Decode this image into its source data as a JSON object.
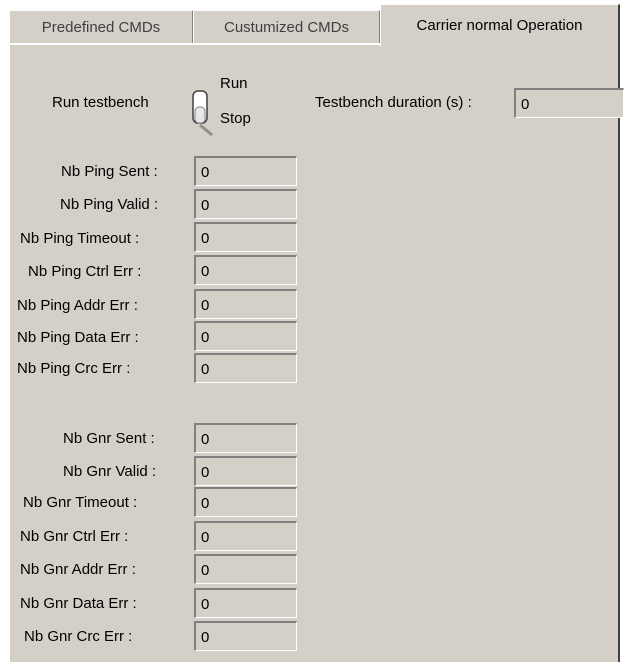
{
  "tabs": [
    {
      "label": "Predefined CMDs",
      "active": false
    },
    {
      "label": "Custumized CMDs",
      "active": false
    },
    {
      "label": "Carrier normal Operation",
      "active": true
    }
  ],
  "testbench": {
    "run_label": "Run testbench",
    "toggle_on_label": "Run",
    "toggle_off_label": "Stop",
    "toggle_state": "Stop",
    "duration_label": "Testbench duration (s) :",
    "duration_value": "0"
  },
  "ping": [
    {
      "label": "Nb Ping Sent :",
      "value": "0"
    },
    {
      "label": "Nb Ping Valid :",
      "value": "0"
    },
    {
      "label": "Nb Ping Timeout :",
      "value": "0"
    },
    {
      "label": "Nb Ping Ctrl Err :",
      "value": "0"
    },
    {
      "label": "Nb Ping Addr Err :",
      "value": "0"
    },
    {
      "label": "Nb Ping Data Err :",
      "value": "0"
    },
    {
      "label": "Nb Ping Crc Err :",
      "value": "0"
    }
  ],
  "gnr": [
    {
      "label": "Nb Gnr Sent :",
      "value": "0"
    },
    {
      "label": "Nb Gnr Valid :",
      "value": "0"
    },
    {
      "label": "Nb Gnr Timeout :",
      "value": "0"
    },
    {
      "label": "Nb Gnr Ctrl Err :",
      "value": "0"
    },
    {
      "label": "Nb Gnr Addr Err :",
      "value": "0"
    },
    {
      "label": "Nb Gnr Data Err :",
      "value": "0"
    },
    {
      "label": "Nb Gnr Crc Err :",
      "value": "0"
    }
  ],
  "colors": {
    "panel": "#d4d0c8",
    "shadow": "#808080",
    "highlight": "#ffffff"
  }
}
